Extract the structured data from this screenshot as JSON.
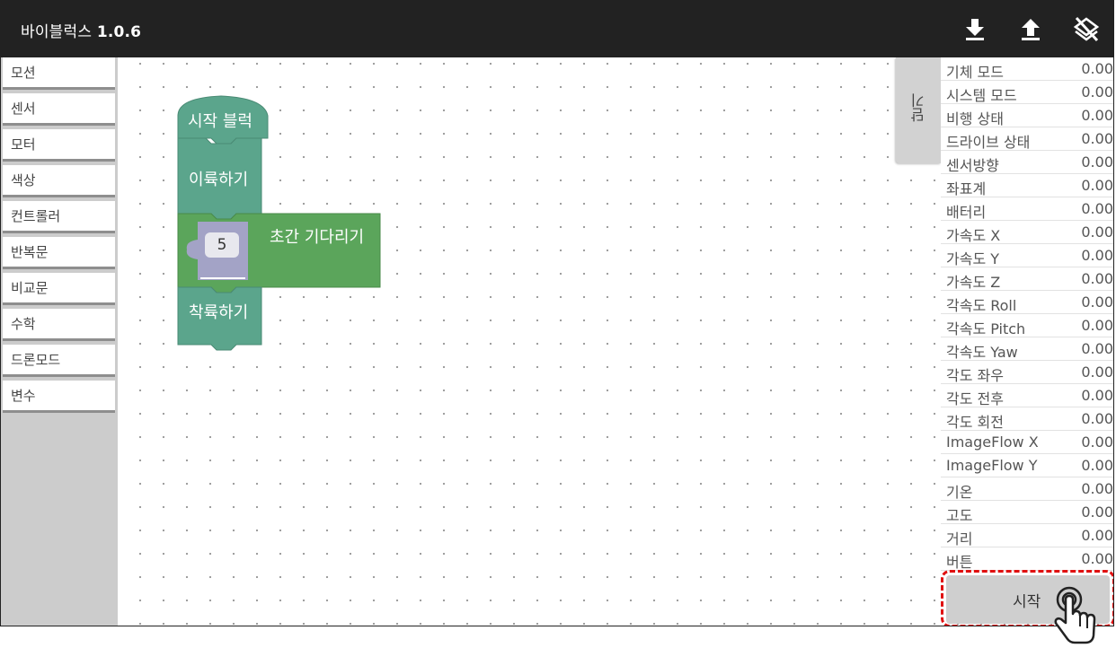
{
  "app": {
    "name": "바이블럭스",
    "version": "1.0.6"
  },
  "toolbar": {
    "download_icon": "download-icon",
    "upload_icon": "upload-icon",
    "clear_icon": "layers-clear-icon"
  },
  "categories": [
    "모션",
    "센서",
    "모터",
    "색상",
    "컨트롤러",
    "반복문",
    "비교문",
    "수학",
    "드론모드",
    "변수"
  ],
  "blocks": {
    "start_label": "시작 블럭",
    "takeoff_label": "이륙하기",
    "wait_label": "초간 기다리기",
    "wait_value": "5",
    "land_label": "착륙하기"
  },
  "colors": {
    "topbar": "#222222",
    "block_teal": "#5ba58c",
    "block_green": "#5ba55b",
    "highlight": "#e01010"
  },
  "close_tab_label": "닫기",
  "sensors": [
    {
      "label": "기체 모드",
      "value": "0.00"
    },
    {
      "label": "시스템 모드",
      "value": "0.00"
    },
    {
      "label": "비행 상태",
      "value": "0.00"
    },
    {
      "label": "드라이브 상태",
      "value": "0.00"
    },
    {
      "label": "센서방향",
      "value": "0.00"
    },
    {
      "label": "좌표계",
      "value": "0.00"
    },
    {
      "label": "배터리",
      "value": "0.00"
    },
    {
      "label": "가속도 X",
      "value": "0.00"
    },
    {
      "label": "가속도 Y",
      "value": "0.00"
    },
    {
      "label": "가속도 Z",
      "value": "0.00"
    },
    {
      "label": "각속도 Roll",
      "value": "0.00"
    },
    {
      "label": "각속도 Pitch",
      "value": "0.00"
    },
    {
      "label": "각속도 Yaw",
      "value": "0.00"
    },
    {
      "label": "각도 좌우",
      "value": "0.00"
    },
    {
      "label": "각도 전후",
      "value": "0.00"
    },
    {
      "label": "각도 회전",
      "value": "0.00"
    },
    {
      "label": "ImageFlow X",
      "value": "0.00"
    },
    {
      "label": "ImageFlow Y",
      "value": "0.00"
    },
    {
      "label": "기온",
      "value": "0.00"
    },
    {
      "label": "고도",
      "value": "0.00"
    },
    {
      "label": "거리",
      "value": "0.00"
    },
    {
      "label": "버튼",
      "value": "0.00"
    }
  ],
  "start_button_label": "시작"
}
